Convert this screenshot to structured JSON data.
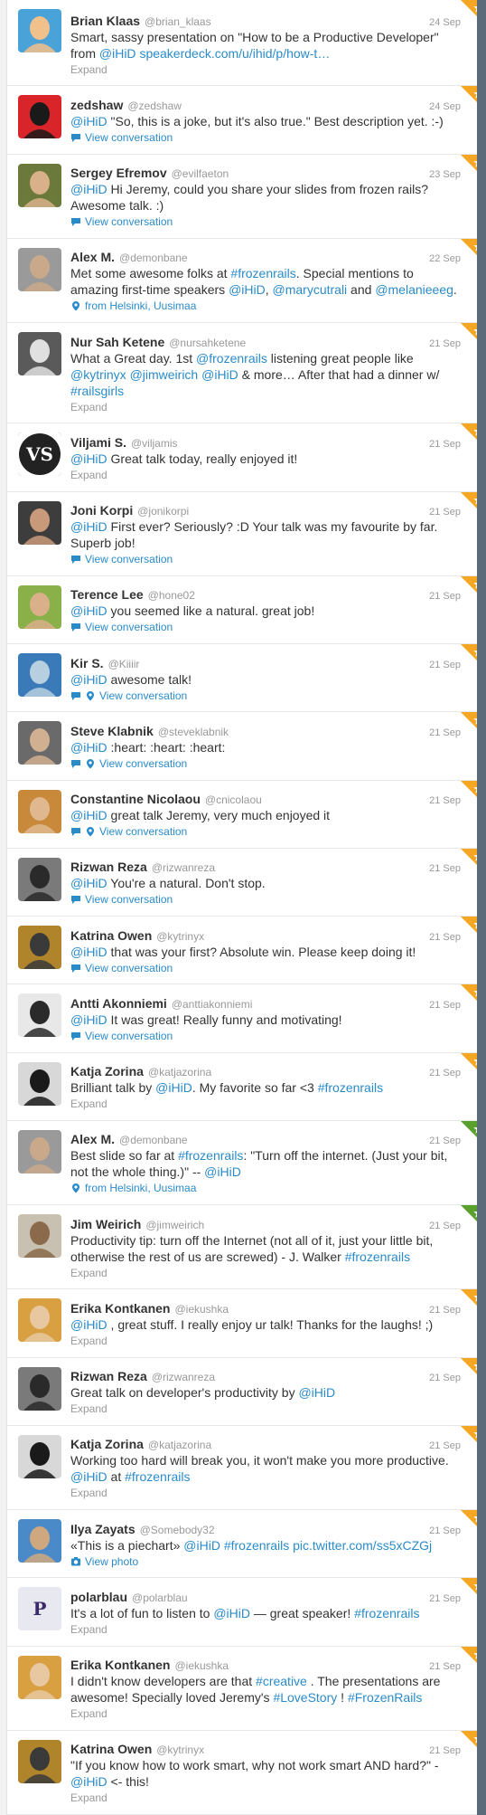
{
  "tweets": [
    {
      "name": "Brian Klaas",
      "handle": "@brian_klaas",
      "time": "24 Sep",
      "segments": [
        {
          "t": "Smart, sassy presentation on \"How to be a Productive Developer\" from "
        },
        {
          "t": "@iHiD",
          "l": 1
        },
        {
          "t": " "
        },
        {
          "t": "speakerdeck.com/u/ihid/p/how-t…",
          "l": 1
        }
      ],
      "action": "Expand",
      "action_type": "expand",
      "avatar": {
        "bg": "#4aa3d8",
        "fg": "#f2c08a"
      },
      "corner": "orange"
    },
    {
      "name": "zedshaw",
      "handle": "@zedshaw",
      "time": "24 Sep",
      "segments": [
        {
          "t": "@iHiD",
          "l": 1
        },
        {
          "t": " \"So, this is a joke, but it's also true.\" Best description yet. :-)"
        }
      ],
      "action": "View conversation",
      "action_type": "conversation",
      "avatar": {
        "bg": "#d9242a",
        "fg": "#1a1a1a"
      },
      "corner": "orange"
    },
    {
      "name": "Sergey Efremov",
      "handle": "@evilfaeton",
      "time": "23 Sep",
      "segments": [
        {
          "t": "@iHiD",
          "l": 1
        },
        {
          "t": " Hi Jeremy, could you share your slides from frozen rails? Awesome talk. :)"
        }
      ],
      "action": "View conversation",
      "action_type": "conversation",
      "avatar": {
        "bg": "#6b7a3a",
        "fg": "#d8b08a"
      },
      "corner": "orange"
    },
    {
      "name": "Alex M.",
      "handle": "@demonbane",
      "time": "22 Sep",
      "segments": [
        {
          "t": "Met some awesome folks at "
        },
        {
          "t": "#frozenrails",
          "l": 1
        },
        {
          "t": ". Special mentions to amazing first-time speakers "
        },
        {
          "t": "@iHiD",
          "l": 1
        },
        {
          "t": ", "
        },
        {
          "t": "@marycutrali",
          "l": 1
        },
        {
          "t": " and "
        },
        {
          "t": "@melanieeeg",
          "l": 1
        },
        {
          "t": "."
        }
      ],
      "action": "from Helsinki, Uusimaa",
      "action_type": "location",
      "avatar": {
        "bg": "#9a9a9a",
        "fg": "#c9a98a"
      },
      "corner": "orange"
    },
    {
      "name": "Nur Sah Ketene",
      "handle": "@nursahketene",
      "time": "21 Sep",
      "segments": [
        {
          "t": "What a Great day. 1st "
        },
        {
          "t": "@frozenrails",
          "l": 1
        },
        {
          "t": " listening great people like "
        },
        {
          "t": "@kytrinyx",
          "l": 1
        },
        {
          "t": " "
        },
        {
          "t": "@jimweirich",
          "l": 1
        },
        {
          "t": " "
        },
        {
          "t": "@iHiD",
          "l": 1
        },
        {
          "t": " & more… After that had a dinner w/ "
        },
        {
          "t": "#railsgirls",
          "l": 1
        }
      ],
      "action": "Expand",
      "action_type": "expand",
      "avatar": {
        "bg": "#5a5a5a",
        "fg": "#e0e0e0"
      },
      "corner": "orange"
    },
    {
      "name": "Viljami S.",
      "handle": "@viljamis",
      "time": "21 Sep",
      "segments": [
        {
          "t": "@iHiD",
          "l": 1
        },
        {
          "t": " Great talk today, really enjoyed it!"
        }
      ],
      "action": "Expand",
      "action_type": "expand",
      "avatar": {
        "bg": "#222222",
        "fg": "#ffffff",
        "letters": "VS",
        "round": 1
      },
      "corner": "orange"
    },
    {
      "name": "Joni Korpi",
      "handle": "@jonikorpi",
      "time": "21 Sep",
      "segments": [
        {
          "t": "@iHiD",
          "l": 1
        },
        {
          "t": " First ever? Seriously? :D Your talk was my favourite by far. Superb job!"
        }
      ],
      "action": "View conversation",
      "action_type": "conversation",
      "avatar": {
        "bg": "#3d3d3d",
        "fg": "#c99a7a"
      },
      "corner": "orange"
    },
    {
      "name": "Terence Lee",
      "handle": "@hone02",
      "time": "21 Sep",
      "segments": [
        {
          "t": "@iHiD",
          "l": 1
        },
        {
          "t": " you seemed like a natural. great job!"
        }
      ],
      "action": "View conversation",
      "action_type": "conversation",
      "avatar": {
        "bg": "#8ab04a",
        "fg": "#d9b08a"
      },
      "corner": "orange"
    },
    {
      "name": "Kir S.",
      "handle": "@Kiiiir",
      "time": "21 Sep",
      "segments": [
        {
          "t": "@iHiD",
          "l": 1
        },
        {
          "t": " awesome talk!"
        }
      ],
      "action": "View conversation",
      "action_type": "conversation_location",
      "avatar": {
        "bg": "#3a7ab8",
        "fg": "#b8cfe0"
      },
      "corner": "orange"
    },
    {
      "name": "Steve Klabnik",
      "handle": "@steveklabnik",
      "time": "21 Sep",
      "segments": [
        {
          "t": "@iHiD",
          "l": 1
        },
        {
          "t": " :heart: :heart: :heart:"
        }
      ],
      "action": "View conversation",
      "action_type": "conversation_location",
      "avatar": {
        "bg": "#6a6a6a",
        "fg": "#d0b090"
      },
      "corner": "orange"
    },
    {
      "name": "Constantine Nicolaou",
      "handle": "@cnicolaou",
      "time": "21 Sep",
      "segments": [
        {
          "t": "@iHiD",
          "l": 1
        },
        {
          "t": " great talk Jeremy, very much enjoyed it"
        }
      ],
      "action": "View conversation",
      "action_type": "conversation_location",
      "avatar": {
        "bg": "#c88a3a",
        "fg": "#e0b890"
      },
      "corner": "orange"
    },
    {
      "name": "Rizwan Reza",
      "handle": "@rizwanreza",
      "time": "21 Sep",
      "segments": [
        {
          "t": "@iHiD",
          "l": 1
        },
        {
          "t": " You're a natural. Don't stop."
        }
      ],
      "action": "View conversation",
      "action_type": "conversation",
      "avatar": {
        "bg": "#7a7a7a",
        "fg": "#2a2a2a"
      },
      "corner": "orange"
    },
    {
      "name": "Katrina Owen",
      "handle": "@kytrinyx",
      "time": "21 Sep",
      "segments": [
        {
          "t": "@iHiD",
          "l": 1
        },
        {
          "t": " that was your first? Absolute win. Please keep doing it!"
        }
      ],
      "action": "View conversation",
      "action_type": "conversation",
      "avatar": {
        "bg": "#b0842a",
        "fg": "#3a3a3a"
      },
      "corner": "orange"
    },
    {
      "name": "Antti Akonniemi",
      "handle": "@anttiakonniemi",
      "time": "21 Sep",
      "segments": [
        {
          "t": "@iHiD",
          "l": 1
        },
        {
          "t": " It was great! Really funny and motivating!"
        }
      ],
      "action": "View conversation",
      "action_type": "conversation",
      "avatar": {
        "bg": "#e8e8e8",
        "fg": "#2a2a2a"
      },
      "corner": "orange"
    },
    {
      "name": "Katja Zorina",
      "handle": "@katjazorina",
      "time": "21 Sep",
      "segments": [
        {
          "t": "Brilliant talk by "
        },
        {
          "t": "@iHiD",
          "l": 1
        },
        {
          "t": ". My favorite so far <3 "
        },
        {
          "t": "#frozenrails",
          "l": 1
        }
      ],
      "action": "Expand",
      "action_type": "expand",
      "avatar": {
        "bg": "#d8d8d8",
        "fg": "#1a1a1a"
      },
      "corner": "orange"
    },
    {
      "name": "Alex M.",
      "handle": "@demonbane",
      "time": "21 Sep",
      "segments": [
        {
          "t": "Best slide so far at "
        },
        {
          "t": "#frozenrails",
          "l": 1
        },
        {
          "t": ": \"Turn off the internet. (Just your bit, not the whole thing.)\" -- "
        },
        {
          "t": "@iHiD",
          "l": 1
        }
      ],
      "action": "from Helsinki, Uusimaa",
      "action_type": "location",
      "avatar": {
        "bg": "#9a9a9a",
        "fg": "#c9a98a"
      },
      "corner": "green"
    },
    {
      "name": "Jim Weirich",
      "handle": "@jimweirich",
      "time": "21 Sep",
      "segments": [
        {
          "t": "Productivity tip: turn off the Internet (not all of it, just your little bit, otherwise the rest of us are screwed) - J. Walker "
        },
        {
          "t": "#frozenrails",
          "l": 1
        }
      ],
      "action": "Expand",
      "action_type": "expand",
      "avatar": {
        "bg": "#c8c0b0",
        "fg": "#8a6a4a"
      },
      "corner": "green"
    },
    {
      "name": "Erika Kontkanen",
      "handle": "@iekushka",
      "time": "21 Sep",
      "segments": [
        {
          "t": "@iHiD",
          "l": 1
        },
        {
          "t": " , great stuff. I really enjoy ur talk! Thanks for the laughs! ;)"
        }
      ],
      "action": "Expand",
      "action_type": "expand",
      "avatar": {
        "bg": "#d8a040",
        "fg": "#e8c8a0"
      },
      "corner": "orange"
    },
    {
      "name": "Rizwan Reza",
      "handle": "@rizwanreza",
      "time": "21 Sep",
      "segments": [
        {
          "t": "Great talk on developer's productivity by "
        },
        {
          "t": "@iHiD",
          "l": 1
        }
      ],
      "action": "Expand",
      "action_type": "expand",
      "avatar": {
        "bg": "#7a7a7a",
        "fg": "#2a2a2a"
      },
      "corner": "orange"
    },
    {
      "name": "Katja Zorina",
      "handle": "@katjazorina",
      "time": "21 Sep",
      "segments": [
        {
          "t": "Working too hard will break you, it won't make you more productive. "
        },
        {
          "t": "@iHiD",
          "l": 1
        },
        {
          "t": " at "
        },
        {
          "t": "#frozenrails",
          "l": 1
        }
      ],
      "action": "Expand",
      "action_type": "expand",
      "avatar": {
        "bg": "#d8d8d8",
        "fg": "#1a1a1a"
      },
      "corner": "orange"
    },
    {
      "name": "Ilya Zayats",
      "handle": "@Somebody32",
      "time": "21 Sep",
      "segments": [
        {
          "t": "«This is a piechart» "
        },
        {
          "t": "@iHiD",
          "l": 1
        },
        {
          "t": " "
        },
        {
          "t": "#frozenrails",
          "l": 1
        },
        {
          "t": " "
        },
        {
          "t": "pic.twitter.com/ss5xCZGj",
          "l": 1
        }
      ],
      "action": "View photo",
      "action_type": "photo",
      "avatar": {
        "bg": "#4a8ac8",
        "fg": "#d0a880"
      },
      "corner": "orange"
    },
    {
      "name": "polarblau",
      "handle": "@polarblau",
      "time": "21 Sep",
      "segments": [
        {
          "t": "It's a lot of fun to listen to "
        },
        {
          "t": "@iHiD",
          "l": 1
        },
        {
          "t": " — great speaker! "
        },
        {
          "t": "#frozenrails",
          "l": 1
        }
      ],
      "action": "Expand",
      "action_type": "expand",
      "avatar": {
        "bg": "#e8e8f0",
        "fg": "#3a2a6a",
        "letters": "P"
      },
      "corner": "orange"
    },
    {
      "name": "Erika Kontkanen",
      "handle": "@iekushka",
      "time": "21 Sep",
      "segments": [
        {
          "t": "I didn't know developers are that "
        },
        {
          "t": "#creative",
          "l": 1
        },
        {
          "t": " . The presentations are awesome! Specially loved Jeremy's "
        },
        {
          "t": "#LoveStory",
          "l": 1
        },
        {
          "t": " ! "
        },
        {
          "t": "#FrozenRails",
          "l": 1
        }
      ],
      "action": "Expand",
      "action_type": "expand",
      "avatar": {
        "bg": "#d8a040",
        "fg": "#e8c8a0"
      },
      "corner": "orange"
    },
    {
      "name": "Katrina Owen",
      "handle": "@kytrinyx",
      "time": "21 Sep",
      "segments": [
        {
          "t": "\"If you know how to work smart, why not work smart AND hard?\" - "
        },
        {
          "t": "@iHiD",
          "l": 1
        },
        {
          "t": " <- this!"
        }
      ],
      "action": "Expand",
      "action_type": "expand",
      "avatar": {
        "bg": "#b0842a",
        "fg": "#3a3a3a"
      },
      "corner": "orange"
    }
  ],
  "colors": {
    "link": "#2a8bc9",
    "muted": "#999999",
    "corner_orange": "#f5a623",
    "corner_green": "#5aa02c"
  }
}
